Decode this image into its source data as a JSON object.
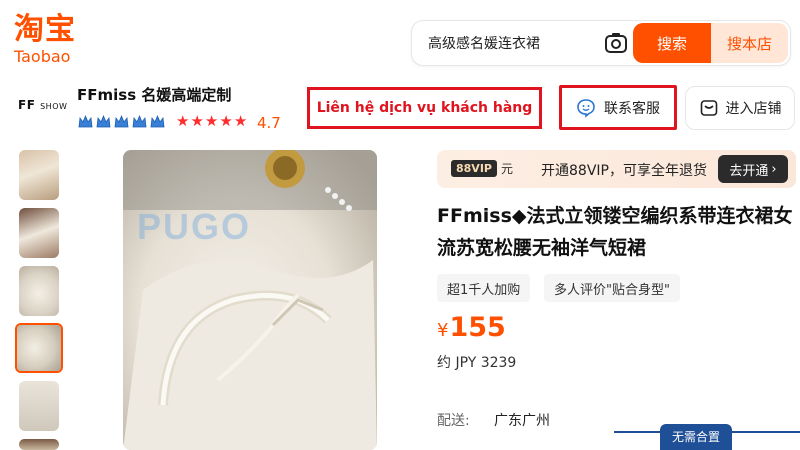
{
  "header": {
    "logo_cn": "淘宝",
    "logo_en": "Taobao",
    "search_value": "高级感名媛连衣裙",
    "search_button": "搜索",
    "store_button": "搜本店"
  },
  "shop": {
    "logo_text": "FF",
    "logo_small": "SHOW",
    "name": "FFmiss 名媛高端定制",
    "rating": "4.7",
    "crown_count": 5,
    "star_count": 5,
    "service_button": "联系客服",
    "enter_store_button": "进入店铺"
  },
  "annotation": {
    "text": "Liên hệ dịch vụ khách hàng"
  },
  "vip": {
    "badge": "88VIP",
    "badge_suffix": "元",
    "text": "开通88VIP，可享全年退货",
    "button": "去开通"
  },
  "product": {
    "title": "FFmiss◆法式立领镂空编织系带连衣裙女流苏宽松腰无袖洋气短裙",
    "tags": [
      "超1千人加购",
      "多人评价\"贴合身型\""
    ],
    "currency": "¥",
    "price": "155",
    "jpy": "约 JPY 3239",
    "shipping_label": "配送:",
    "shipping_value": "广东广州",
    "assemble_button": "无需合置"
  },
  "gallery": {
    "watermark": "PUGO",
    "thumbnail_count": 6,
    "selected_index": 3
  },
  "colors": {
    "brand": "#ff5000",
    "annotation_red": "#e0141e",
    "vip_dark": "#2b2b2b",
    "assemble_blue": "#1f4f96"
  }
}
